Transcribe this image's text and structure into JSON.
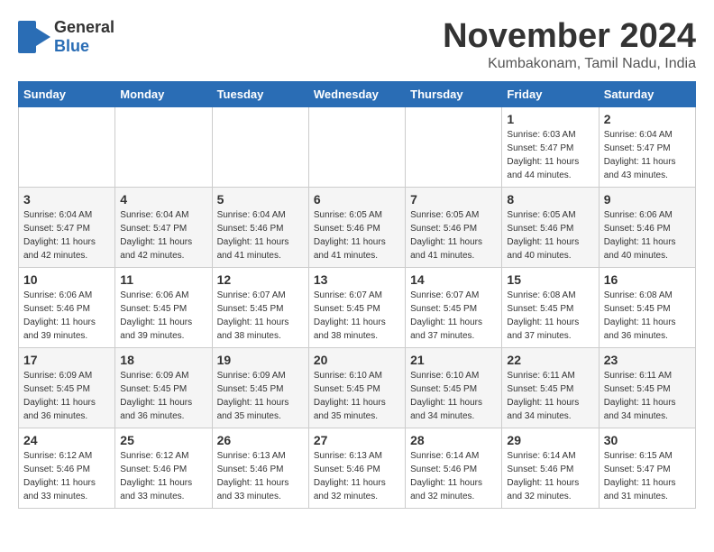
{
  "header": {
    "logo_general": "General",
    "logo_blue": "Blue",
    "month": "November 2024",
    "location": "Kumbakonam, Tamil Nadu, India"
  },
  "days_of_week": [
    "Sunday",
    "Monday",
    "Tuesday",
    "Wednesday",
    "Thursday",
    "Friday",
    "Saturday"
  ],
  "weeks": [
    [
      {
        "day": "",
        "info": ""
      },
      {
        "day": "",
        "info": ""
      },
      {
        "day": "",
        "info": ""
      },
      {
        "day": "",
        "info": ""
      },
      {
        "day": "",
        "info": ""
      },
      {
        "day": "1",
        "info": "Sunrise: 6:03 AM\nSunset: 5:47 PM\nDaylight: 11 hours\nand 44 minutes."
      },
      {
        "day": "2",
        "info": "Sunrise: 6:04 AM\nSunset: 5:47 PM\nDaylight: 11 hours\nand 43 minutes."
      }
    ],
    [
      {
        "day": "3",
        "info": "Sunrise: 6:04 AM\nSunset: 5:47 PM\nDaylight: 11 hours\nand 42 minutes."
      },
      {
        "day": "4",
        "info": "Sunrise: 6:04 AM\nSunset: 5:47 PM\nDaylight: 11 hours\nand 42 minutes."
      },
      {
        "day": "5",
        "info": "Sunrise: 6:04 AM\nSunset: 5:46 PM\nDaylight: 11 hours\nand 41 minutes."
      },
      {
        "day": "6",
        "info": "Sunrise: 6:05 AM\nSunset: 5:46 PM\nDaylight: 11 hours\nand 41 minutes."
      },
      {
        "day": "7",
        "info": "Sunrise: 6:05 AM\nSunset: 5:46 PM\nDaylight: 11 hours\nand 41 minutes."
      },
      {
        "day": "8",
        "info": "Sunrise: 6:05 AM\nSunset: 5:46 PM\nDaylight: 11 hours\nand 40 minutes."
      },
      {
        "day": "9",
        "info": "Sunrise: 6:06 AM\nSunset: 5:46 PM\nDaylight: 11 hours\nand 40 minutes."
      }
    ],
    [
      {
        "day": "10",
        "info": "Sunrise: 6:06 AM\nSunset: 5:46 PM\nDaylight: 11 hours\nand 39 minutes."
      },
      {
        "day": "11",
        "info": "Sunrise: 6:06 AM\nSunset: 5:45 PM\nDaylight: 11 hours\nand 39 minutes."
      },
      {
        "day": "12",
        "info": "Sunrise: 6:07 AM\nSunset: 5:45 PM\nDaylight: 11 hours\nand 38 minutes."
      },
      {
        "day": "13",
        "info": "Sunrise: 6:07 AM\nSunset: 5:45 PM\nDaylight: 11 hours\nand 38 minutes."
      },
      {
        "day": "14",
        "info": "Sunrise: 6:07 AM\nSunset: 5:45 PM\nDaylight: 11 hours\nand 37 minutes."
      },
      {
        "day": "15",
        "info": "Sunrise: 6:08 AM\nSunset: 5:45 PM\nDaylight: 11 hours\nand 37 minutes."
      },
      {
        "day": "16",
        "info": "Sunrise: 6:08 AM\nSunset: 5:45 PM\nDaylight: 11 hours\nand 36 minutes."
      }
    ],
    [
      {
        "day": "17",
        "info": "Sunrise: 6:09 AM\nSunset: 5:45 PM\nDaylight: 11 hours\nand 36 minutes."
      },
      {
        "day": "18",
        "info": "Sunrise: 6:09 AM\nSunset: 5:45 PM\nDaylight: 11 hours\nand 36 minutes."
      },
      {
        "day": "19",
        "info": "Sunrise: 6:09 AM\nSunset: 5:45 PM\nDaylight: 11 hours\nand 35 minutes."
      },
      {
        "day": "20",
        "info": "Sunrise: 6:10 AM\nSunset: 5:45 PM\nDaylight: 11 hours\nand 35 minutes."
      },
      {
        "day": "21",
        "info": "Sunrise: 6:10 AM\nSunset: 5:45 PM\nDaylight: 11 hours\nand 34 minutes."
      },
      {
        "day": "22",
        "info": "Sunrise: 6:11 AM\nSunset: 5:45 PM\nDaylight: 11 hours\nand 34 minutes."
      },
      {
        "day": "23",
        "info": "Sunrise: 6:11 AM\nSunset: 5:45 PM\nDaylight: 11 hours\nand 34 minutes."
      }
    ],
    [
      {
        "day": "24",
        "info": "Sunrise: 6:12 AM\nSunset: 5:46 PM\nDaylight: 11 hours\nand 33 minutes."
      },
      {
        "day": "25",
        "info": "Sunrise: 6:12 AM\nSunset: 5:46 PM\nDaylight: 11 hours\nand 33 minutes."
      },
      {
        "day": "26",
        "info": "Sunrise: 6:13 AM\nSunset: 5:46 PM\nDaylight: 11 hours\nand 33 minutes."
      },
      {
        "day": "27",
        "info": "Sunrise: 6:13 AM\nSunset: 5:46 PM\nDaylight: 11 hours\nand 32 minutes."
      },
      {
        "day": "28",
        "info": "Sunrise: 6:14 AM\nSunset: 5:46 PM\nDaylight: 11 hours\nand 32 minutes."
      },
      {
        "day": "29",
        "info": "Sunrise: 6:14 AM\nSunset: 5:46 PM\nDaylight: 11 hours\nand 32 minutes."
      },
      {
        "day": "30",
        "info": "Sunrise: 6:15 AM\nSunset: 5:47 PM\nDaylight: 11 hours\nand 31 minutes."
      }
    ]
  ]
}
